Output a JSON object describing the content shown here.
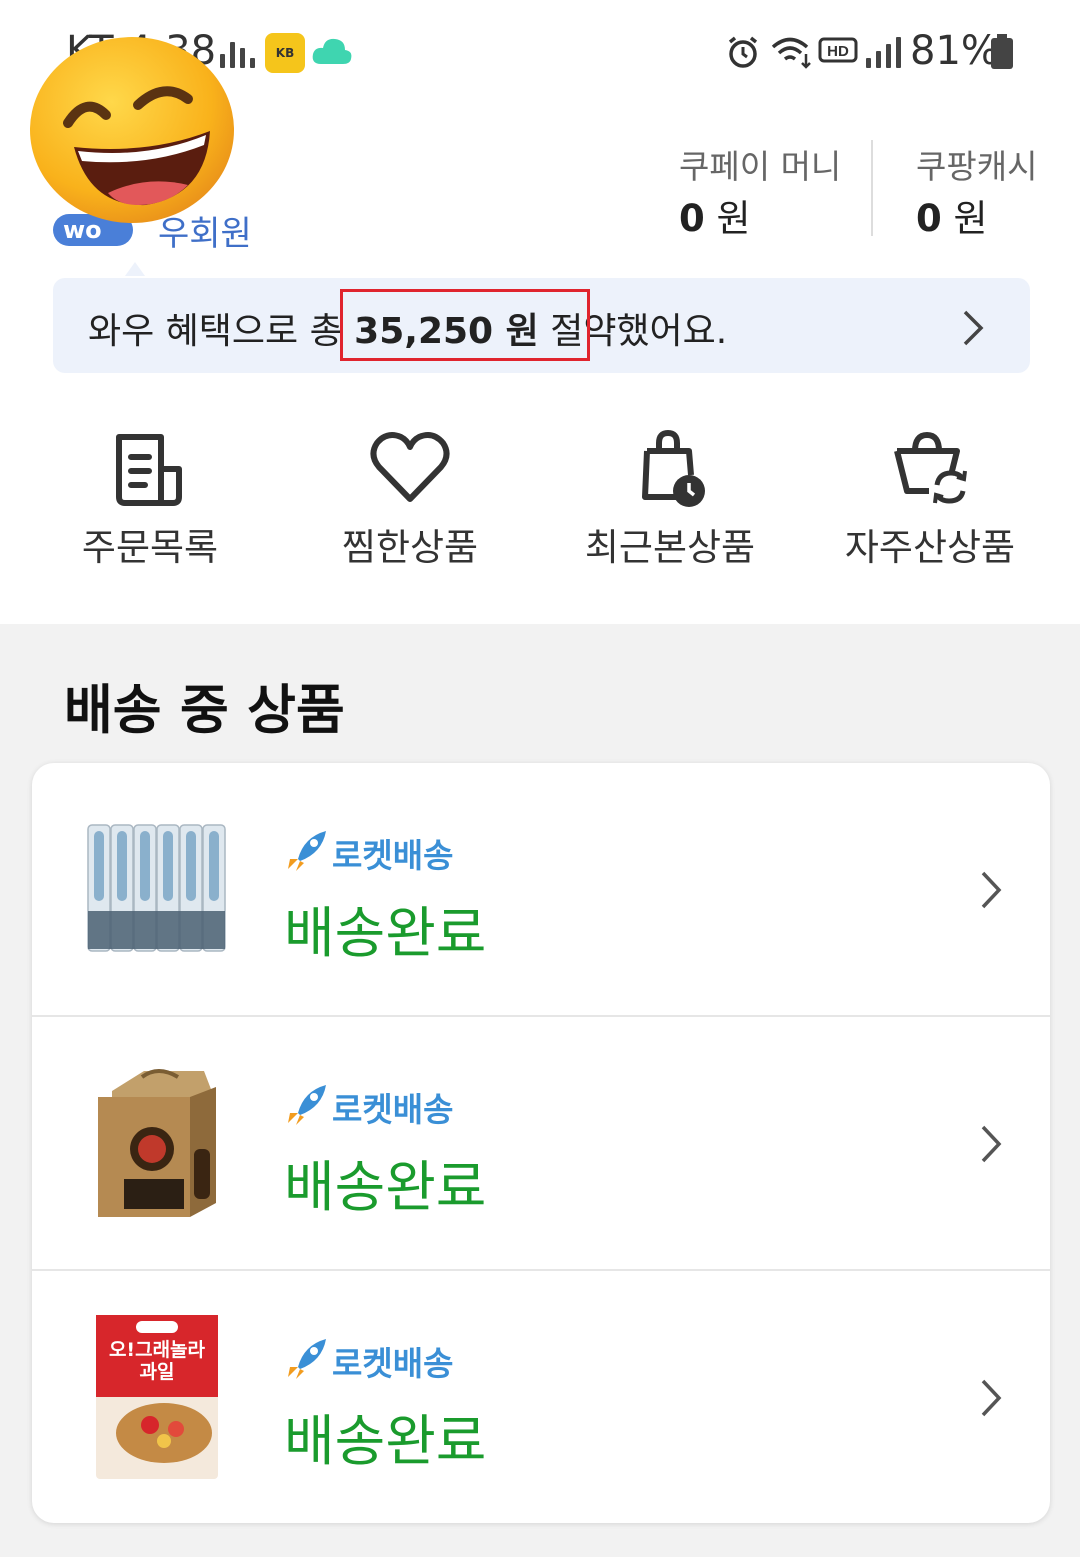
{
  "status_bar": {
    "carrier": "KT 4:38",
    "battery": "81%"
  },
  "profile": {
    "badge_prefix": "wo",
    "membership": "우회원"
  },
  "wallet": {
    "coupay_label": "쿠페이 머니",
    "coupay_amount": "0",
    "coupay_unit": "원",
    "coupangcash_label": "쿠팡캐시",
    "coupangcash_amount": "0",
    "coupangcash_unit": "원"
  },
  "savings": {
    "prefix": "와우 혜택으로 총 ",
    "amount": "35,250 원",
    "suffix": " 절약했어요."
  },
  "quick_menu": [
    {
      "label": "주문목록",
      "icon": "receipt-icon"
    },
    {
      "label": "찜한상품",
      "icon": "heart-icon"
    },
    {
      "label": "최근본상품",
      "icon": "recent-bag-icon"
    },
    {
      "label": "자주산상품",
      "icon": "reorder-cart-icon"
    }
  ],
  "delivery": {
    "title": "배송 중 상품",
    "items": [
      {
        "shipping": "로켓배송",
        "status": "배송완료"
      },
      {
        "shipping": "로켓배송",
        "status": "배송완료"
      },
      {
        "shipping": "로켓배송",
        "status": "배송완료"
      }
    ]
  },
  "product_image_text": {
    "cereal_name": "오!그래놀라 과일"
  },
  "colors": {
    "status_green": "#1a9b2d",
    "rocket_blue": "#3a8fd6",
    "highlight_red": "#e0242e",
    "banner_bg": "#edf2fb"
  }
}
